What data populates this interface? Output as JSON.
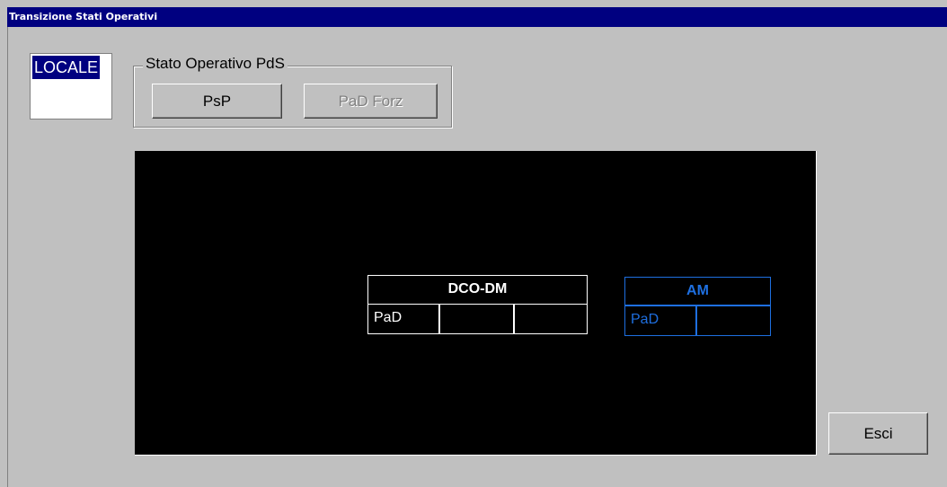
{
  "window": {
    "title": "Transizione Stati Operativi"
  },
  "mode": {
    "label": "LOCALE"
  },
  "stato_operativo": {
    "legend": "Stato Operativo PdS",
    "psp_label": "PsP",
    "pad_forz_label": "PaD Forz"
  },
  "diagram": {
    "dco_block": {
      "title": "DCO-DM",
      "state": "PaD",
      "color": "#ffffff"
    },
    "am_block": {
      "title": "AM",
      "state": "PaD",
      "color": "#1e6fe0"
    }
  },
  "footer": {
    "exit_label": "Esci"
  },
  "colors": {
    "titlebar": "#000080",
    "window_bg": "#c0c0c0",
    "canvas_bg": "#000000"
  }
}
